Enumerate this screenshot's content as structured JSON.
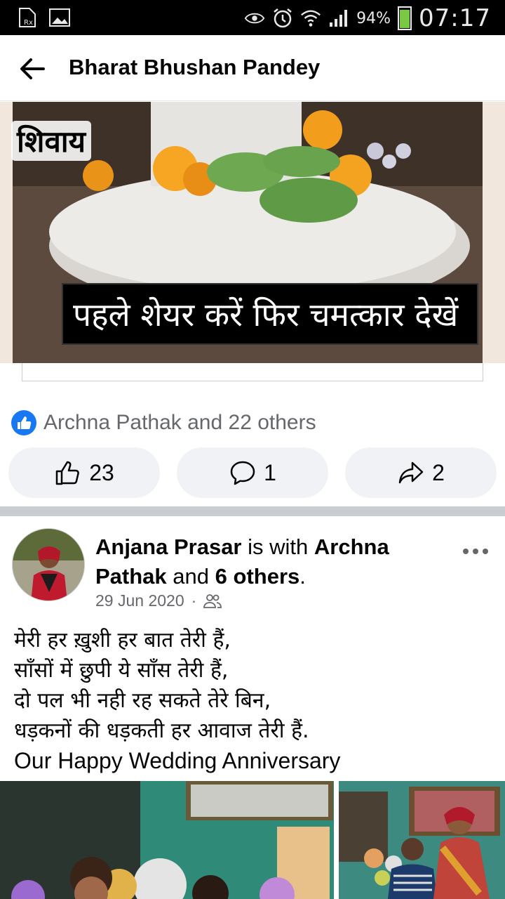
{
  "status_bar": {
    "battery": "94%",
    "time": "07:17"
  },
  "header": {
    "title": "Bharat Bhushan Pandey"
  },
  "shared_image": {
    "overlay_text": "शिवाय",
    "banner_text": "पहले शेयर करें फिर चमत्कार देखें"
  },
  "reactions": {
    "summary": "Archna Pathak and 22 others"
  },
  "actions": {
    "like_count": "23",
    "comment_count": "1",
    "share_count": "2"
  },
  "post": {
    "author": "Anjana Prasar",
    "with_word": "is with",
    "tagged": "Archna Pathak",
    "and_word": "and",
    "others": "6 others",
    "date": "29 Jun 2020",
    "separator": "·",
    "lines": [
      "मेरी हर ख़ुशी हर बात तेरी हैं,",
      "साँसों में छुपी ये साँस तेरी हैं,",
      "दो पल भी नही रह सकते तेरे बिन,",
      "धड़कनों की धड़कती हर आवाज तेरी हैं.",
      "Our Happy Wedding Anniversary"
    ]
  },
  "colors": {
    "accent": "#1877f2",
    "button_bg": "#f0f2f5",
    "secondary_text": "#65676b"
  }
}
